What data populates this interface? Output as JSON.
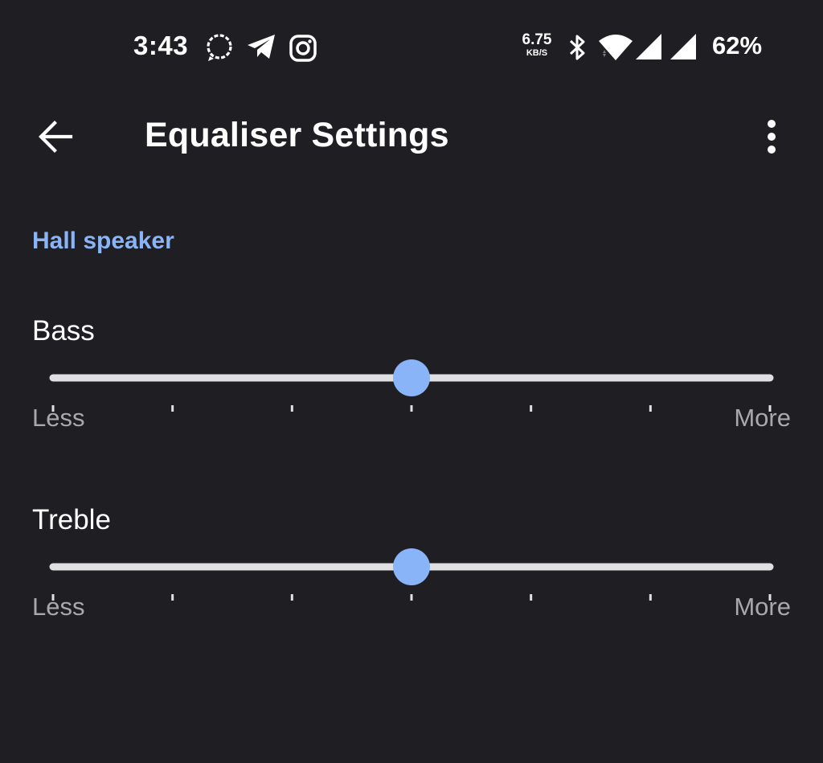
{
  "status_bar": {
    "time": "3:43",
    "notification_icons": [
      "signal-messenger-icon",
      "telegram-icon",
      "instagram-icon"
    ],
    "net_speed_value": "6.75",
    "net_speed_unit": "KB/S",
    "system_icons": [
      "bluetooth-icon",
      "wifi-icon",
      "cellular-signal-icon",
      "cellular-signal-icon"
    ],
    "battery": "62%"
  },
  "app_bar": {
    "title": "Equaliser Settings",
    "back_icon": "arrow-back-icon",
    "menu_icon": "more-vert-icon"
  },
  "section": {
    "header": "Hall speaker"
  },
  "equaliser": [
    {
      "label": "Bass",
      "min_label": "Less",
      "max_label": "More",
      "steps": 7,
      "value_step": 3
    },
    {
      "label": "Treble",
      "min_label": "Less",
      "max_label": "More",
      "steps": 7,
      "value_step": 3
    }
  ],
  "colors": {
    "background": "#1f1f23",
    "accent": "#8ab4f8",
    "track": "#e0e0e3",
    "secondary_text": "#a8a8ad"
  }
}
